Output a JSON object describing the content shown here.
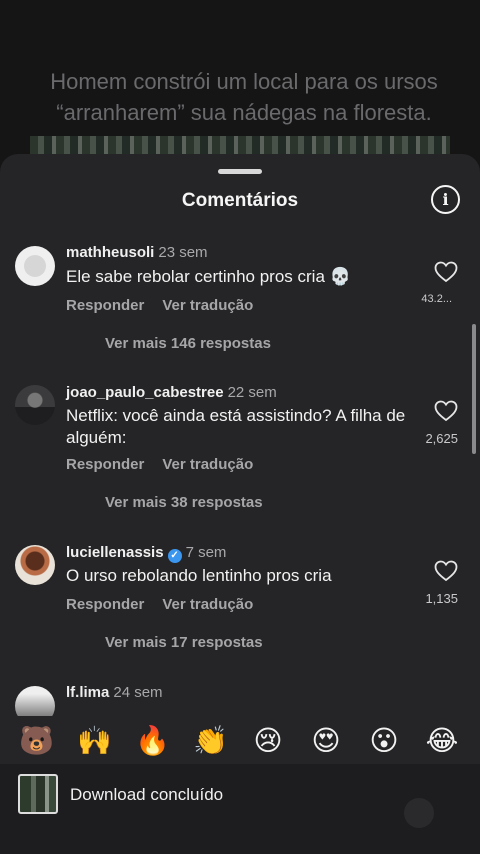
{
  "background": {
    "caption": "Homem constrói um local para os ursos “arranharem” sua nádegas na floresta."
  },
  "sheet": {
    "title": "Comentários",
    "info_icon": "info-icon"
  },
  "comments": [
    {
      "username": "mathheusoli",
      "time": "23 sem",
      "text": "Ele sabe rebolar certinho pros cria 💀",
      "reply_label": "Responder",
      "translate_label": "Ver tradução",
      "more_label": "Ver mais 146 respostas",
      "likes": "43.2..."
    },
    {
      "username": "joao_paulo_cabestree",
      "time": "22 sem",
      "text": "Netflix: você ainda está assistindo? A filha de alguém:",
      "reply_label": "Responder",
      "translate_label": "Ver tradução",
      "more_label": "Ver mais 38 respostas",
      "likes": "2,625"
    },
    {
      "username": "luciellenassis",
      "time": "7 sem",
      "verified": true,
      "text": "O urso rebolando lentinho pros cria",
      "reply_label": "Responder",
      "translate_label": "Ver tradução",
      "more_label": "Ver mais 17 respostas",
      "likes": "1,135"
    },
    {
      "username": "lf.lima",
      "time": "24 sem"
    }
  ],
  "emoji_bar": [
    "🐻",
    "🙌",
    "🔥",
    "👏",
    "😢",
    "😍",
    "😮",
    "😂"
  ],
  "toast": {
    "text": "Download concluído"
  }
}
